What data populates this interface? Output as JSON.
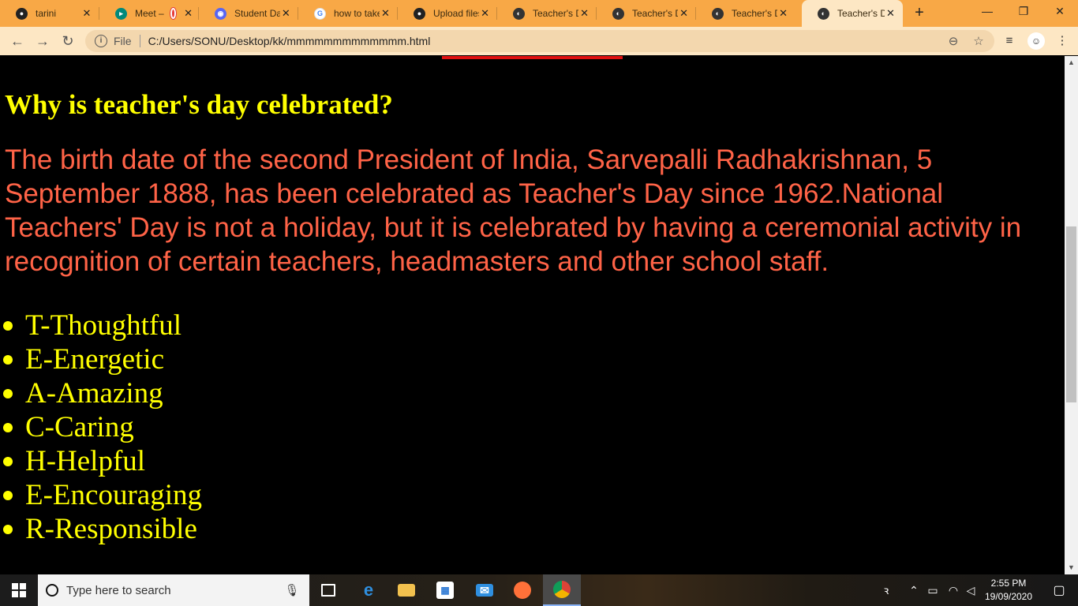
{
  "browser": {
    "tabs": [
      {
        "label": "tarini",
        "icon": "github-icon"
      },
      {
        "label": "Meet –",
        "icon": "meet-icon"
      },
      {
        "label": "Student Da",
        "icon": "classroom-icon"
      },
      {
        "label": "how to take",
        "icon": "google-icon"
      },
      {
        "label": "Upload files",
        "icon": "github-icon"
      },
      {
        "label": "Teacher's D",
        "icon": "page-icon"
      },
      {
        "label": "Teacher's D",
        "icon": "page-icon"
      },
      {
        "label": "Teacher's D",
        "icon": "page-icon"
      },
      {
        "label": "Teacher's D",
        "icon": "page-icon",
        "active": true
      }
    ],
    "new_tab_label": "+",
    "window_controls": {
      "minimize": "—",
      "maximize": "❐",
      "close": "✕"
    },
    "address": {
      "scheme_label": "File",
      "url": "C:/Users/SONU/Desktop/kk/mmmmmmmmmmmmm.html"
    },
    "accent_color": "#f8a846"
  },
  "page": {
    "heading": "Why is teacher's day celebrated?",
    "paragraph": "The birth date of the second President of India, Sarvepalli Radhakrishnan, 5 September 1888, has been celebrated as Teacher's Day since 1962.National Teachers' Day is not a holiday, but it is celebrated by having a ceremonial activity in recognition of certain teachers, headmasters and other school staff.",
    "acrostic": [
      "T-Thoughtful",
      "E-Energetic",
      "A-Amazing",
      "C-Caring",
      "H-Helpful",
      "E-Encouraging",
      "R-Responsible"
    ],
    "colors": {
      "background": "#000000",
      "heading": "#ffff00",
      "paragraph": "#ff6347",
      "list": "#ffff00",
      "top_bar": "#e01010"
    }
  },
  "taskbar": {
    "search_placeholder": "Type here to search",
    "clock_time": "2:55 PM",
    "clock_date": "19/09/2020",
    "apps": [
      "task-view-icon",
      "edge-icon",
      "file-explorer-icon",
      "store-icon",
      "mail-icon",
      "firefox-icon",
      "chrome-icon"
    ]
  }
}
